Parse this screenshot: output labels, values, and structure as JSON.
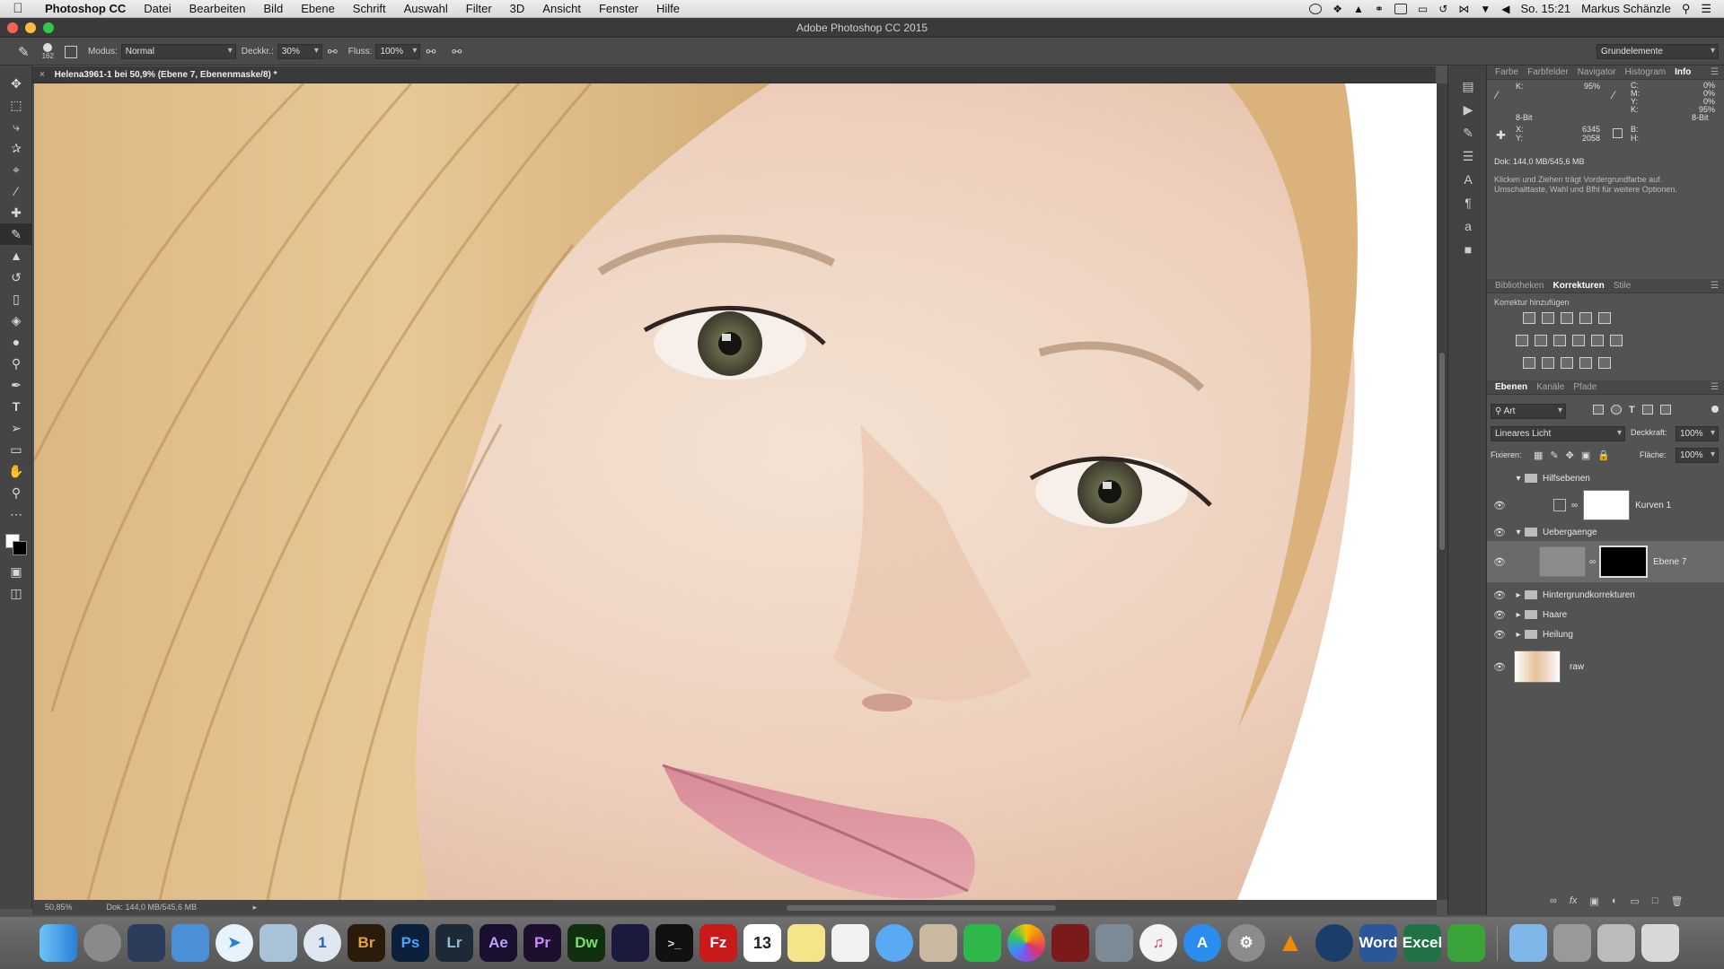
{
  "menubar": {
    "items": [
      "Photoshop CC",
      "Datei",
      "Bearbeiten",
      "Bild",
      "Ebene",
      "Schrift",
      "Auswahl",
      "Filter",
      "3D",
      "Ansicht",
      "Fenster",
      "Hilfe"
    ],
    "clock": "So. 15:21",
    "user": "Markus Schänzle"
  },
  "window": {
    "title": "Adobe Photoshop CC 2015"
  },
  "options": {
    "brush_size": "162",
    "modus_label": "Modus:",
    "modus_value": "Normal",
    "opacity_label": "Deckkr.:",
    "opacity_value": "30%",
    "flow_label": "Fluss:",
    "flow_value": "100%",
    "workspace": "Grundelemente"
  },
  "document": {
    "tab_title": "Helena3961-1 bei 50,9% (Ebene 7, Ebenenmaske/8) *",
    "zoom": "50,85%",
    "doc_size": "Dok: 144,0 MB/545,6 MB"
  },
  "info_panel": {
    "tabs": [
      "Farbe",
      "Farbfelder",
      "Navigator",
      "Histogram",
      "Info"
    ],
    "active_tab": "Info",
    "k_left_label": "K:",
    "k_left_value": "95%",
    "bit_left": "8-Bit",
    "cmyk_labels": [
      "C:",
      "M:",
      "Y:",
      "K:"
    ],
    "cmyk_values": [
      "0%",
      "0%",
      "0%",
      "95%"
    ],
    "bit_right": "8-Bit",
    "x_label": "X:",
    "x_value": "6345",
    "y_label": "Y:",
    "y_value": "2058",
    "w_label": "B:",
    "h_label": "H:",
    "doc_size": "Dok: 144,0 MB/545,6 MB",
    "hint": "Klicken und Ziehen trägt Vordergrundfarbe auf. Umschalttaste, Wahl und Bfhl für weitere Optionen."
  },
  "adjust_panel": {
    "tabs": [
      "Bibliotheken",
      "Korrekturen",
      "Stile"
    ],
    "active_tab": "Korrekturen",
    "heading": "Korrektur hinzufügen"
  },
  "layers_panel": {
    "tabs": [
      "Ebenen",
      "Kanäle",
      "Pfade"
    ],
    "active_tab": "Ebenen",
    "filter_label": "Art",
    "blend_mode": "Lineares Licht",
    "opacity_label": "Deckkraft:",
    "opacity_value": "100%",
    "lock_label": "Fixieren:",
    "fill_label": "Fläche:",
    "fill_value": "100%",
    "layers": [
      {
        "name": "Hilfsebenen",
        "kind": "group-open"
      },
      {
        "name": "Kurven 1",
        "kind": "adjustment"
      },
      {
        "name": "Uebergaenge",
        "kind": "group-open"
      },
      {
        "name": "Ebene 7",
        "kind": "layer-mask",
        "selected": true
      },
      {
        "name": "Hintergrundkorrekturen",
        "kind": "group"
      },
      {
        "name": "Haare",
        "kind": "group"
      },
      {
        "name": "Heilung",
        "kind": "group"
      },
      {
        "name": "raw",
        "kind": "image"
      }
    ]
  },
  "dock": {
    "apps": [
      "Br",
      "Ps",
      "Lr",
      "Ae",
      "Pr",
      "Dw",
      "Fz",
      "Word",
      "Excel"
    ],
    "calendar_day": "13"
  },
  "colors": {
    "ps_dark": "#535353",
    "dock_ps": "#0c1f3b",
    "dock_ps_text": "#4ea3ff",
    "dock_br": "#2b1b0b",
    "dock_br_text": "#e8a23a",
    "dock_lr": "#1b2a36",
    "dock_lr_text": "#9ab8d4",
    "dock_ae": "#1a0f2e",
    "dock_ae_text": "#b9a2ff",
    "dock_pr": "#1e0f2e",
    "dock_pr_text": "#c98cff",
    "dock_dw": "#0f2f0f",
    "dock_dw_text": "#79e06b"
  }
}
